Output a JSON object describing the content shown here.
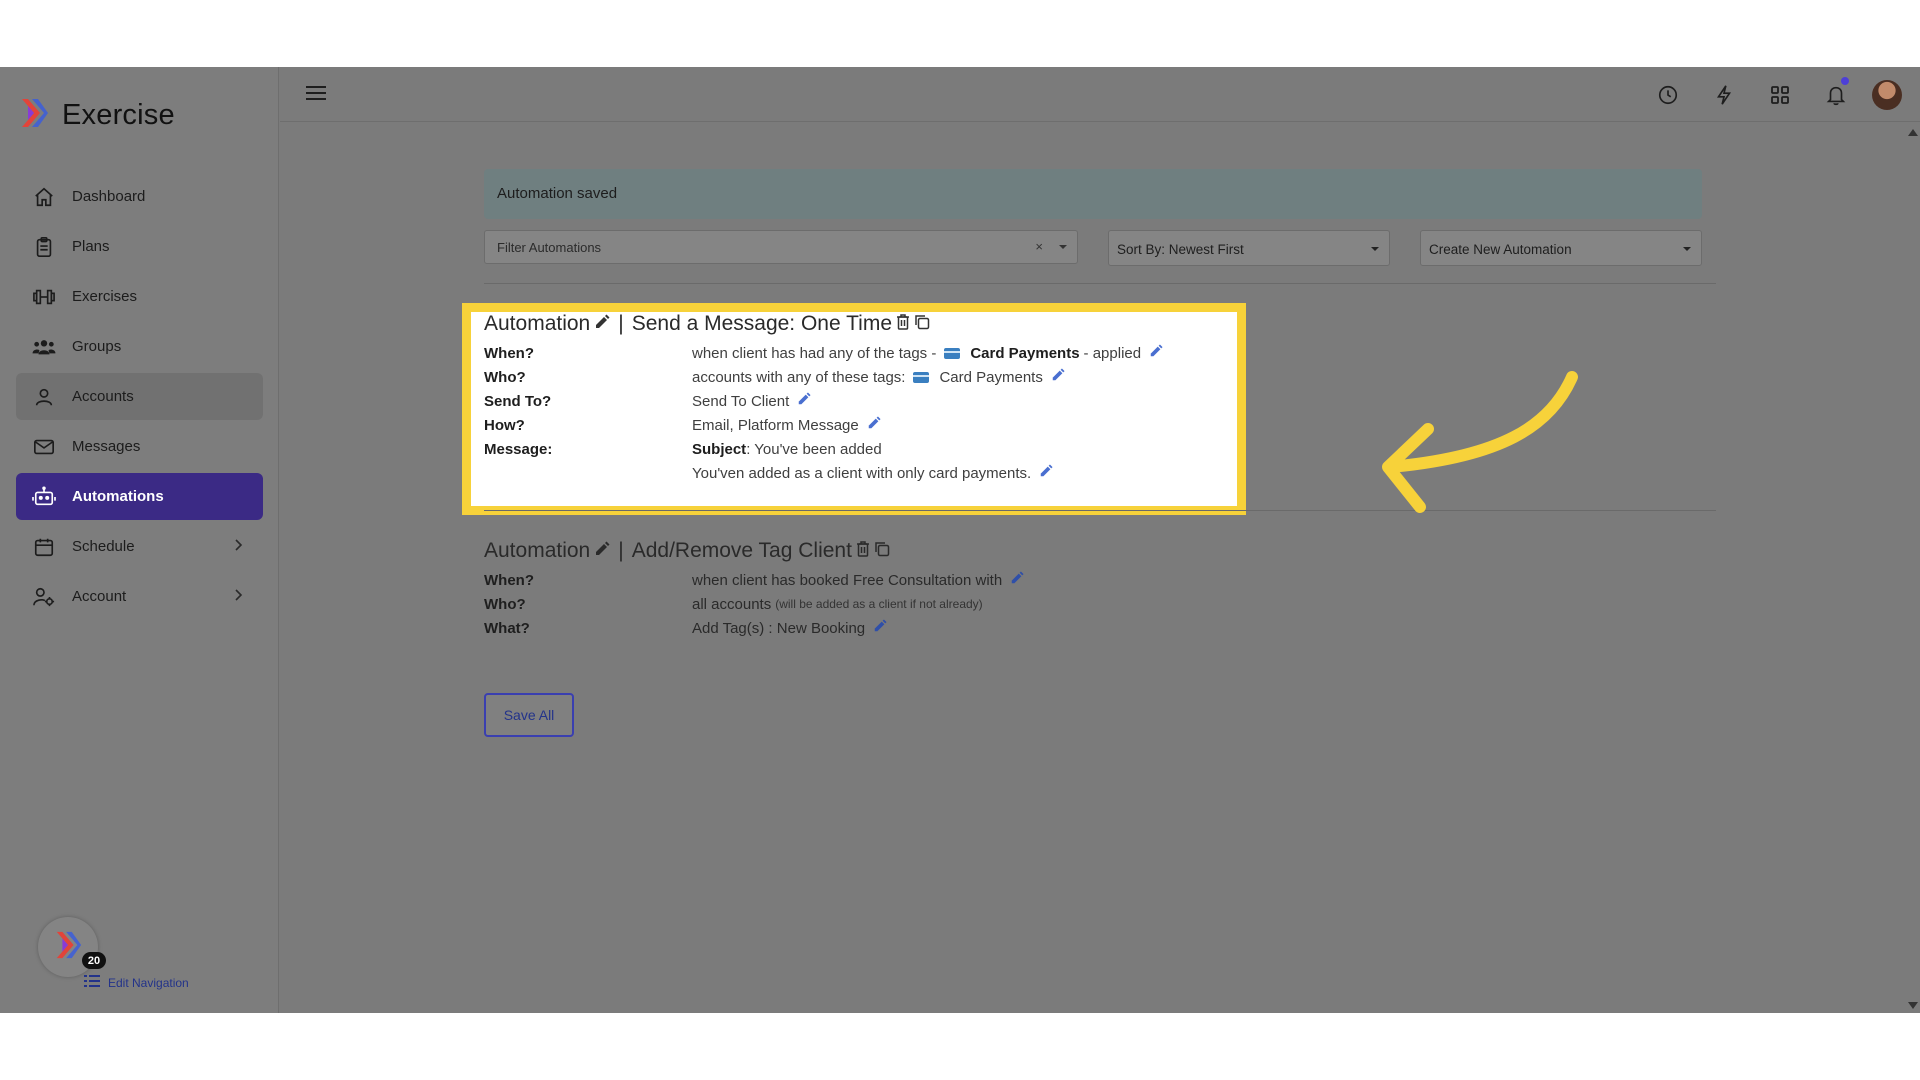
{
  "app": {
    "brand": "Exercise"
  },
  "sidebar": {
    "items": [
      {
        "label": "Dashboard",
        "icon": "home-icon"
      },
      {
        "label": "Plans",
        "icon": "clipboard-icon"
      },
      {
        "label": "Exercises",
        "icon": "dumbbell-icon"
      },
      {
        "label": "Groups",
        "icon": "users-icon"
      },
      {
        "label": "Accounts",
        "icon": "user-icon"
      },
      {
        "label": "Messages",
        "icon": "envelope-icon"
      },
      {
        "label": "Automations",
        "icon": "robot-icon"
      },
      {
        "label": "Schedule",
        "icon": "calendar-icon"
      },
      {
        "label": "Account",
        "icon": "user-gear-icon"
      }
    ],
    "badge_count": "20",
    "edit_navigation": "Edit Navigation"
  },
  "alert": {
    "text": "Automation saved"
  },
  "filters": {
    "filter_placeholder": "Filter Automations",
    "clear": "×",
    "sort": "Sort By: Newest First",
    "create": "Create New Automation"
  },
  "automations": [
    {
      "title": "Automation",
      "type": "Send a Message: One Time",
      "rows": {
        "when_label": "When?",
        "when_pre": "when client has had any of the tags -",
        "when_tag": "Card Payments",
        "when_post": "- applied",
        "who_label": "Who?",
        "who_pre": "accounts with any of these tags:",
        "who_tag": "Card Payments",
        "sendto_label": "Send To?",
        "sendto_value": "Send To Client",
        "how_label": "How?",
        "how_value": "Email, Platform Message",
        "message_label": "Message:",
        "subject_label": "Subject",
        "subject_value": ": You've been added",
        "body": "You'ven added as a client with only card payments."
      }
    },
    {
      "title": "Automation",
      "type": "Add/Remove Tag Client",
      "rows": {
        "when_label": "When?",
        "when_value": "when client has booked Free Consultation with",
        "who_label": "Who?",
        "who_value": "all accounts",
        "who_note": "(will be added as a client if not already)",
        "what_label": "What?",
        "what_value": "Add Tag(s) : New Booking"
      }
    }
  ],
  "actions": {
    "save_all": "Save All"
  },
  "colors": {
    "active_nav": "#3b2a85",
    "highlight": "#f7d23a",
    "link": "#23338a"
  }
}
